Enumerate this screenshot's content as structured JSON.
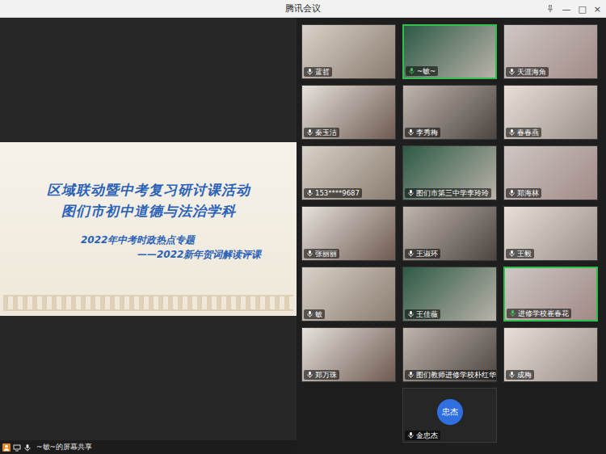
{
  "window": {
    "title": "腾讯会议",
    "controls": [
      "—",
      "□",
      "×"
    ]
  },
  "share": {
    "label": "~敏~的屏幕共享",
    "slide": {
      "title_lines": [
        "区域联动暨中考复习研讨课活动",
        "图们市初中道德与法治学科"
      ],
      "subtitle": "2022年中考时政热点专题",
      "subtitle2": "——2022新年贺词解读评课"
    }
  },
  "participants": [
    {
      "name": "蓝哲",
      "kind": "video",
      "speaking": false,
      "avatar": ""
    },
    {
      "name": "~敏~",
      "kind": "video",
      "speaking": true,
      "avatar": ""
    },
    {
      "name": "天涯海角",
      "kind": "video",
      "speaking": false,
      "avatar": ""
    },
    {
      "name": "秦玉洁",
      "kind": "video",
      "speaking": false,
      "avatar": ""
    },
    {
      "name": "李秀梅",
      "kind": "video",
      "speaking": false,
      "avatar": ""
    },
    {
      "name": "春春燕",
      "kind": "video",
      "speaking": false,
      "avatar": ""
    },
    {
      "name": "153****9687",
      "kind": "video",
      "speaking": false,
      "avatar": ""
    },
    {
      "name": "图们市第三中学李玲玲",
      "kind": "video",
      "speaking": false,
      "avatar": ""
    },
    {
      "name": "郑海林",
      "kind": "video",
      "speaking": false,
      "avatar": ""
    },
    {
      "name": "张丽丽",
      "kind": "video",
      "speaking": false,
      "avatar": ""
    },
    {
      "name": "王淑环",
      "kind": "video",
      "speaking": false,
      "avatar": ""
    },
    {
      "name": "王毅",
      "kind": "video",
      "speaking": false,
      "avatar": ""
    },
    {
      "name": "敏",
      "kind": "video",
      "speaking": false,
      "avatar": ""
    },
    {
      "name": "王佳薇",
      "kind": "video",
      "speaking": false,
      "avatar": ""
    },
    {
      "name": "进修学校崔春花",
      "kind": "video",
      "speaking": true,
      "avatar": ""
    },
    {
      "name": "郑万珠",
      "kind": "video",
      "speaking": false,
      "avatar": ""
    },
    {
      "name": "图们教师进修学校朴红华",
      "kind": "video",
      "speaking": false,
      "avatar": ""
    },
    {
      "name": "成梅",
      "kind": "video",
      "speaking": false,
      "avatar": ""
    },
    {
      "name": "金忠杰",
      "kind": "avatar",
      "speaking": false,
      "avatar": "忠杰"
    }
  ]
}
